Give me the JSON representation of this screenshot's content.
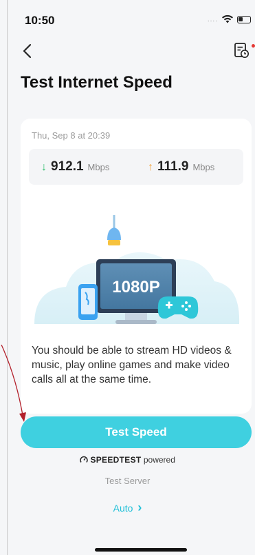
{
  "status_bar": {
    "time": "10:50",
    "signal": "....",
    "icons": [
      "wifi-icon",
      "battery-icon"
    ]
  },
  "nav": {
    "back_icon": "chevron-left-icon",
    "history_icon": "report-clock-icon"
  },
  "page": {
    "title": "Test Internet Speed"
  },
  "result_card": {
    "date": "Thu, Sep 8 at 20:39",
    "download": {
      "arrow": "↓",
      "value": "912.1",
      "unit": "Mbps",
      "color": "#2ebf6b"
    },
    "upload": {
      "arrow": "↑",
      "value": "111.9",
      "unit": "Mbps",
      "color": "#f2a23a"
    },
    "illustration_label": "1080P",
    "description": "You should be able to stream HD videos & music, play online games and make video calls all at the same time."
  },
  "actions": {
    "test_button_label": "Test Speed",
    "accent_color": "#3fd0e0"
  },
  "powered_by": {
    "brand": "SPEEDTEST",
    "suffix": "powered"
  },
  "server": {
    "label": "Test Server",
    "value": "Auto",
    "chevron": "›"
  }
}
